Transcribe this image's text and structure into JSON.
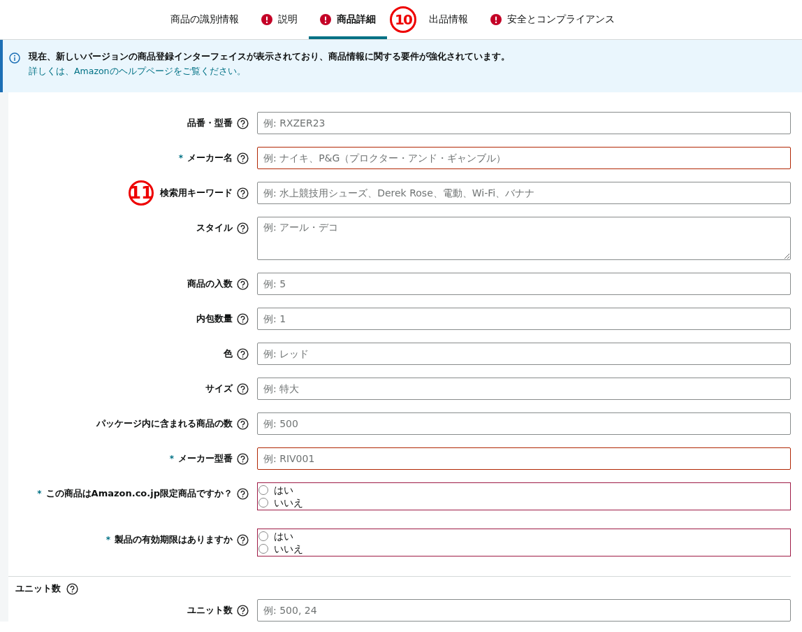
{
  "tabs": [
    {
      "label": "商品の識別情報",
      "selected": false,
      "error": false
    },
    {
      "label": "説明",
      "selected": false,
      "error": true
    },
    {
      "label": "商品詳細",
      "selected": true,
      "error": true
    },
    {
      "label": "出品情報",
      "selected": false,
      "error": false
    },
    {
      "label": "安全とコンプライアンス",
      "selected": false,
      "error": true
    }
  ],
  "tab_callout": "10",
  "required_mark": "*",
  "notice": {
    "message": "現在、新しいバージョンの商品登録インターフェイスが表示されており、商品情報に関する要件が強化されています。",
    "link": "詳しくは、Amazonのヘルプページをご覧ください。"
  },
  "fields": [
    {
      "kind": "text",
      "label": "品番・型番",
      "required": false,
      "placeholder": "例: RXZER23"
    },
    {
      "kind": "text",
      "label": "メーカー名",
      "required": true,
      "placeholder": "例: ナイキ、P&G（プロクター・アンド・ギャンブル）"
    },
    {
      "kind": "text",
      "label": "検索用キーワード",
      "required": false,
      "placeholder": "例: 水上競技用シューズ、Derek Rose、電動、Wi-Fi、バナナ",
      "callout": "11"
    },
    {
      "kind": "textarea",
      "label": "スタイル",
      "required": false,
      "placeholder": "例: アール・デコ"
    },
    {
      "kind": "text",
      "label": "商品の入数",
      "required": false,
      "placeholder": "例: 5"
    },
    {
      "kind": "text",
      "label": "内包数量",
      "required": false,
      "placeholder": "例: 1"
    },
    {
      "kind": "text",
      "label": "色",
      "required": false,
      "placeholder": "例: レッド"
    },
    {
      "kind": "text",
      "label": "サイズ",
      "required": false,
      "placeholder": "例: 特大"
    },
    {
      "kind": "text",
      "label": "パッケージ内に含まれる商品の数",
      "required": false,
      "placeholder": "例: 500"
    },
    {
      "kind": "text",
      "label": "メーカー型番",
      "required": true,
      "placeholder": "例: RIV001"
    },
    {
      "kind": "radio",
      "label": "この商品はAmazon.co.jp限定商品ですか？",
      "required": true,
      "options": [
        {
          "label": "はい",
          "selected": false
        },
        {
          "label": "いいえ",
          "selected": false
        }
      ]
    },
    {
      "kind": "radio",
      "label": "製品の有効期限はありますか",
      "required": true,
      "options": [
        {
          "label": "はい",
          "selected": false
        },
        {
          "label": "いいえ",
          "selected": false
        }
      ]
    }
  ],
  "section": {
    "title": "ユニット数",
    "fields": [
      {
        "kind": "text",
        "label": "ユニット数",
        "required": false,
        "placeholder": "例: 500, 24"
      }
    ]
  }
}
